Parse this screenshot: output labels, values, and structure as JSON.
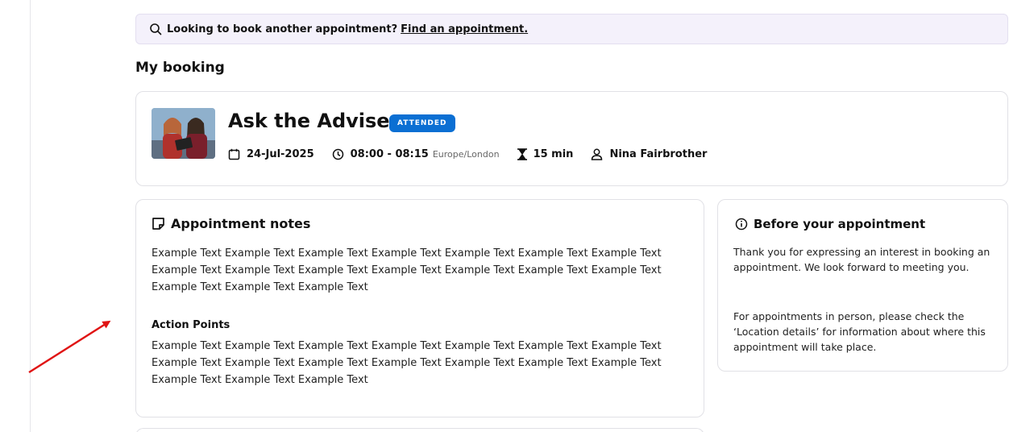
{
  "banner": {
    "icon": "search-icon",
    "text": "Looking to book another appointment?",
    "link_text": "Find an appointment."
  },
  "page_title": "My booking",
  "booking": {
    "title": "Ask the Adviser",
    "status": "ATTENDED",
    "status_color": "#0b6fd3",
    "date": "24-Jul-2025",
    "time": "08:00 - 08:15",
    "timezone": "Europe/London",
    "duration": "15 min",
    "adviser": "Nina Fairbrother"
  },
  "notes": {
    "heading": "Appointment notes",
    "text": "Example Text Example Text Example Text Example Text Example Text Example Text Example Text Example Text Example Text Example Text Example Text Example Text Example Text Example Text Example Text Example Text Example Text",
    "action_points_label": "Action Points",
    "action_points_text": "Example Text Example Text Example Text Example Text Example Text Example Text Example Text Example Text Example Text Example Text Example Text Example Text Example Text Example Text Example Text Example Text Example Text"
  },
  "before": {
    "heading": "Before your appointment",
    "p1": "Thank you for expressing an interest in booking an appointment. We look forward to meeting you.",
    "p2": "For appointments in person, please check the ‘Location details’ for information about where this appointment will take place."
  },
  "colors": {
    "banner_bg": "#f4f1fb",
    "annotation_arrow": "#e01414"
  }
}
